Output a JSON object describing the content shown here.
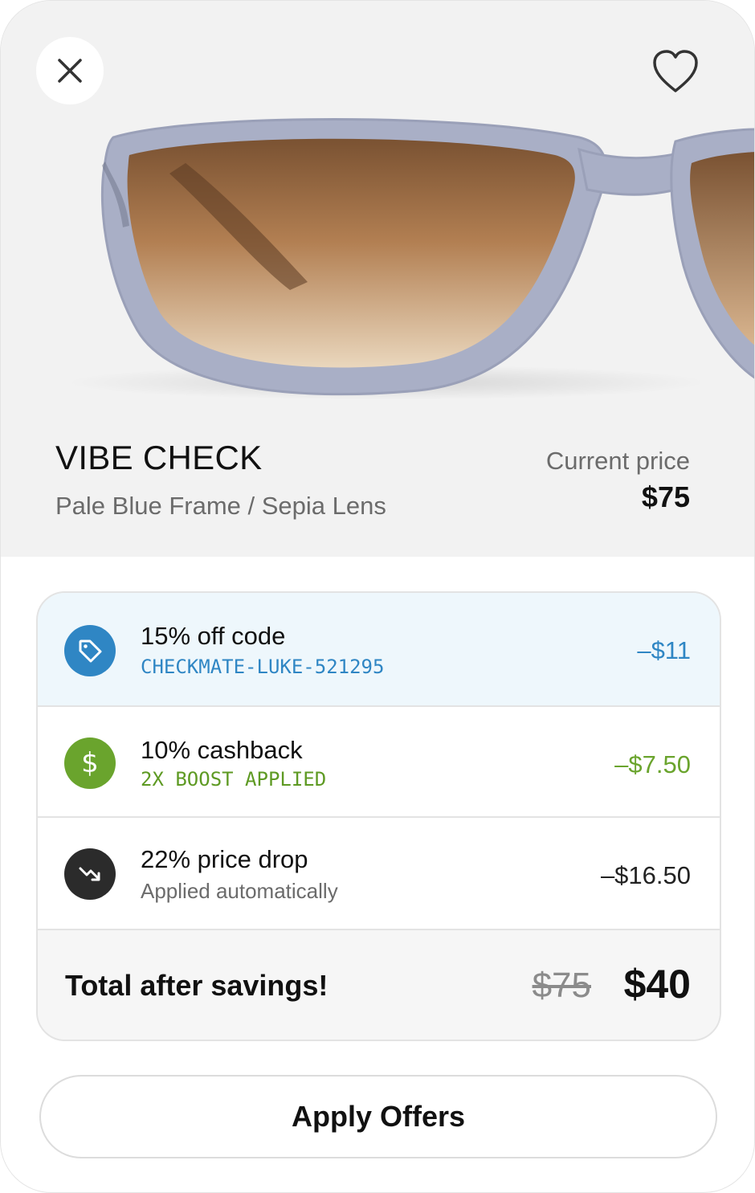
{
  "product": {
    "name": "VIBE CHECK",
    "variant": "Pale Blue Frame / Sepia Lens",
    "price_label": "Current price",
    "price": "$75"
  },
  "icons": {
    "close": "close-icon",
    "favorite": "heart-icon",
    "tag": "tag-icon",
    "cashback": "dollar-icon",
    "price_drop": "trending-down-icon"
  },
  "offers": [
    {
      "title": "15% off code",
      "subtitle": "CHECKMATE-LUKE-521295",
      "amount": "–$11",
      "color": "#2f86c4"
    },
    {
      "title": "10% cashback",
      "subtitle": "2X BOOST APPLIED",
      "amount": "–$7.50",
      "color": "#6aa42d"
    },
    {
      "title": "22% price drop",
      "subtitle": "Applied automatically",
      "amount": "–$16.50",
      "color": "#2b2b2b"
    }
  ],
  "total": {
    "label": "Total after savings!",
    "original": "$75",
    "final": "$40"
  },
  "cta": {
    "label": "Apply Offers"
  }
}
